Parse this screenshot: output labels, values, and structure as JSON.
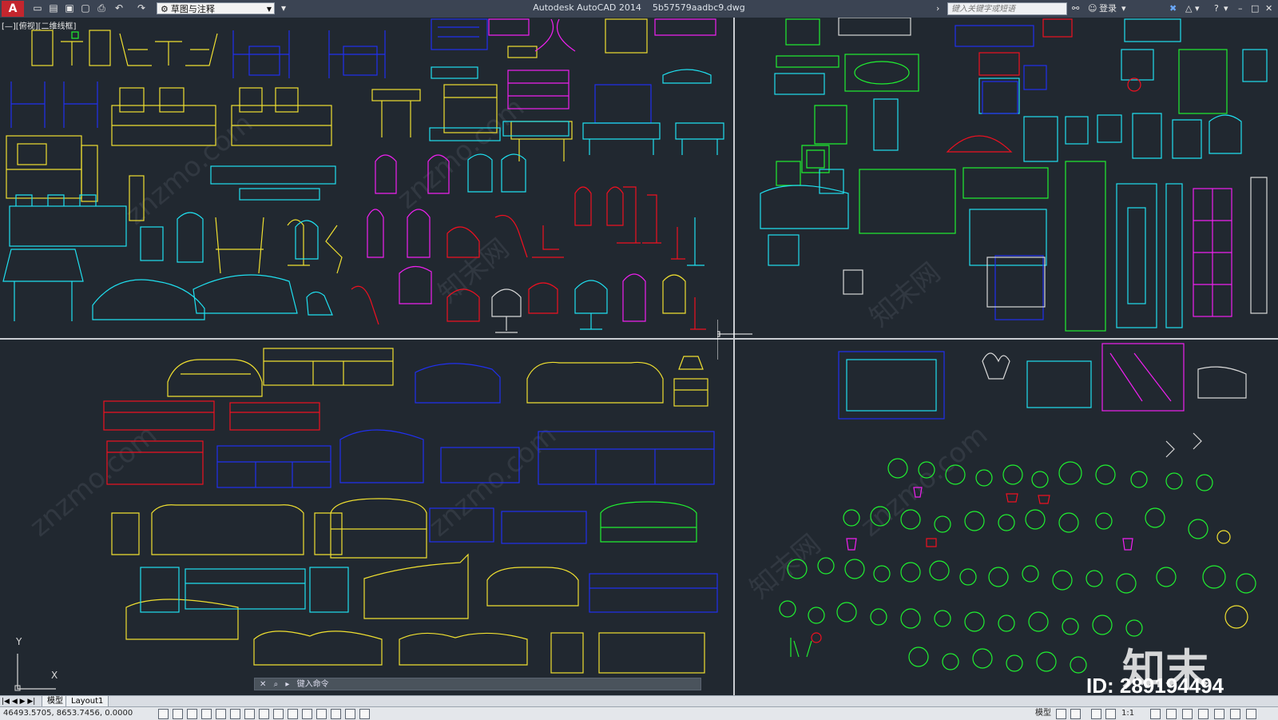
{
  "app": {
    "title": "Autodesk AutoCAD 2014",
    "filename": "5b57579aadbc9.dwg",
    "workspace": "草图与注释",
    "search_placeholder": "键入关键字或短语",
    "login": "登录",
    "help": "?",
    "logo_letter": "A"
  },
  "viewport": {
    "label": "[—][俯视][二维线框]"
  },
  "command": {
    "placeholder": "键入命令"
  },
  "tabs": {
    "model": "模型",
    "layout1": "Layout1"
  },
  "status": {
    "coords": "46493.5705, 8653.7456, 0.0000",
    "model": "模型",
    "scale": "1:1"
  },
  "watermark": {
    "site": "znzmo.com",
    "site_cn": "知末网",
    "brand": "知末",
    "id": "ID: 289194494"
  },
  "ucs": {
    "x": "X",
    "y": "Y"
  },
  "colors": {
    "background": "#212830",
    "cyan": "#1fe0f0",
    "yellow": "#f0e030",
    "blue": "#2030f0",
    "red": "#f01020",
    "magenta": "#f020f0",
    "green": "#20f030",
    "white": "#d8d8d8"
  }
}
